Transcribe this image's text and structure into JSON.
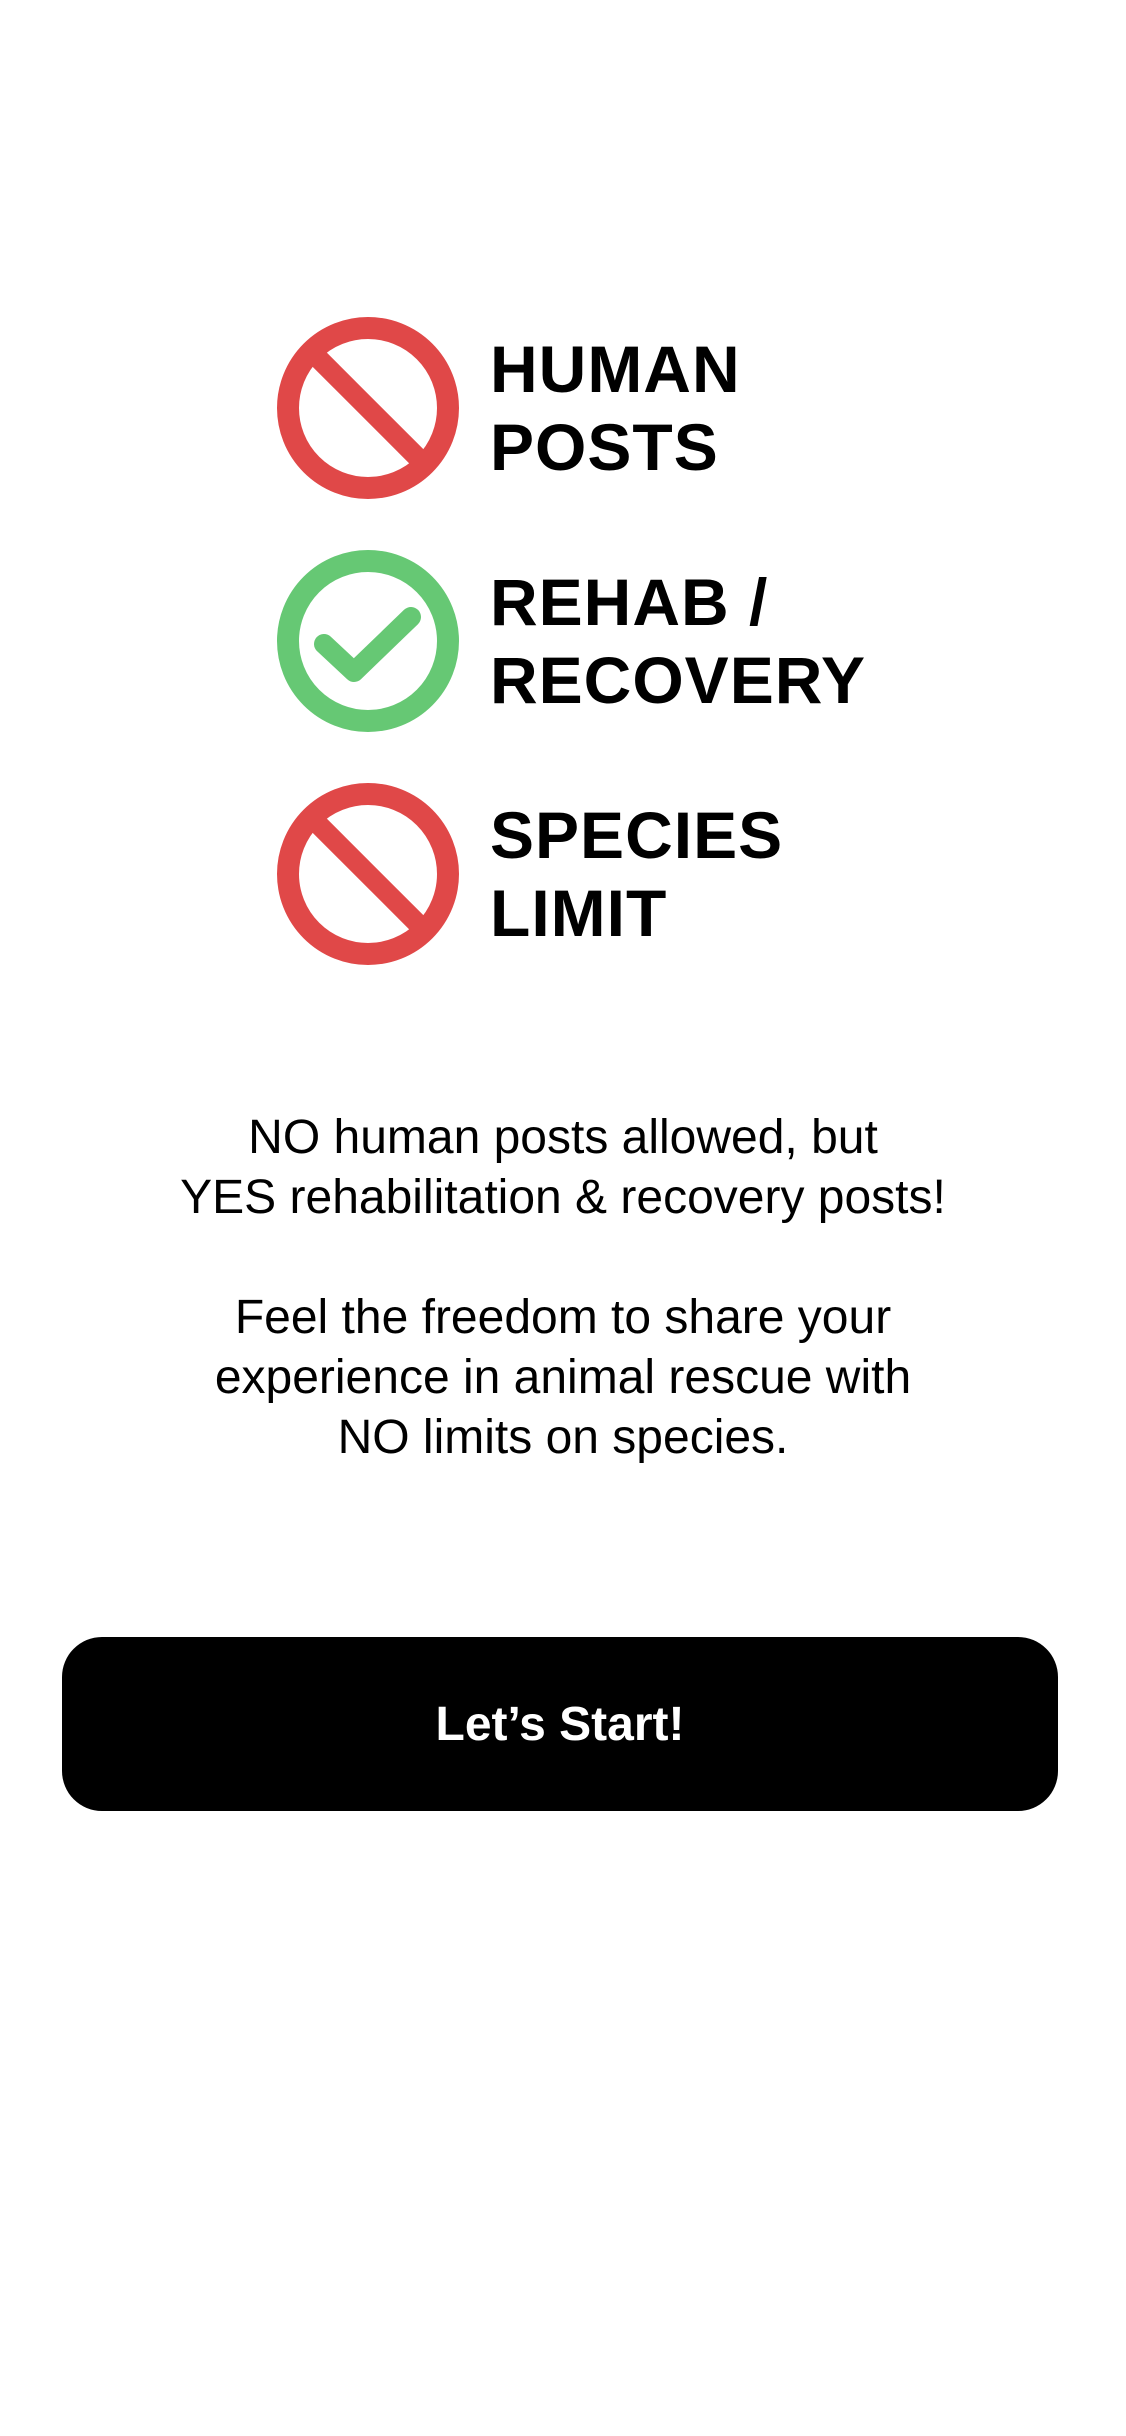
{
  "colors": {
    "prohibited": "#e04848",
    "allowed": "#66c874",
    "text": "#000000",
    "button_bg": "#000000",
    "button_text": "#ffffff",
    "background": "#ffffff"
  },
  "rules": [
    {
      "icon": "prohibited-icon",
      "line1": "HUMAN",
      "line2": "POSTS",
      "status": "not allowed"
    },
    {
      "icon": "check-circle-icon",
      "line1": "REHAB /",
      "line2": "RECOVERY",
      "status": "allowed"
    },
    {
      "icon": "prohibited-icon",
      "line1": "SPECIES",
      "line2": "LIMIT",
      "status": "not allowed"
    }
  ],
  "description": {
    "para1_line1": "NO human posts allowed, but",
    "para1_line2": "YES rehabilitation & recovery posts!",
    "para2_line1": "Feel the freedom to share your",
    "para2_line2": "experience in animal rescue with",
    "para2_line3": "NO limits on species."
  },
  "start_button": {
    "label": "Let’s Start!"
  }
}
